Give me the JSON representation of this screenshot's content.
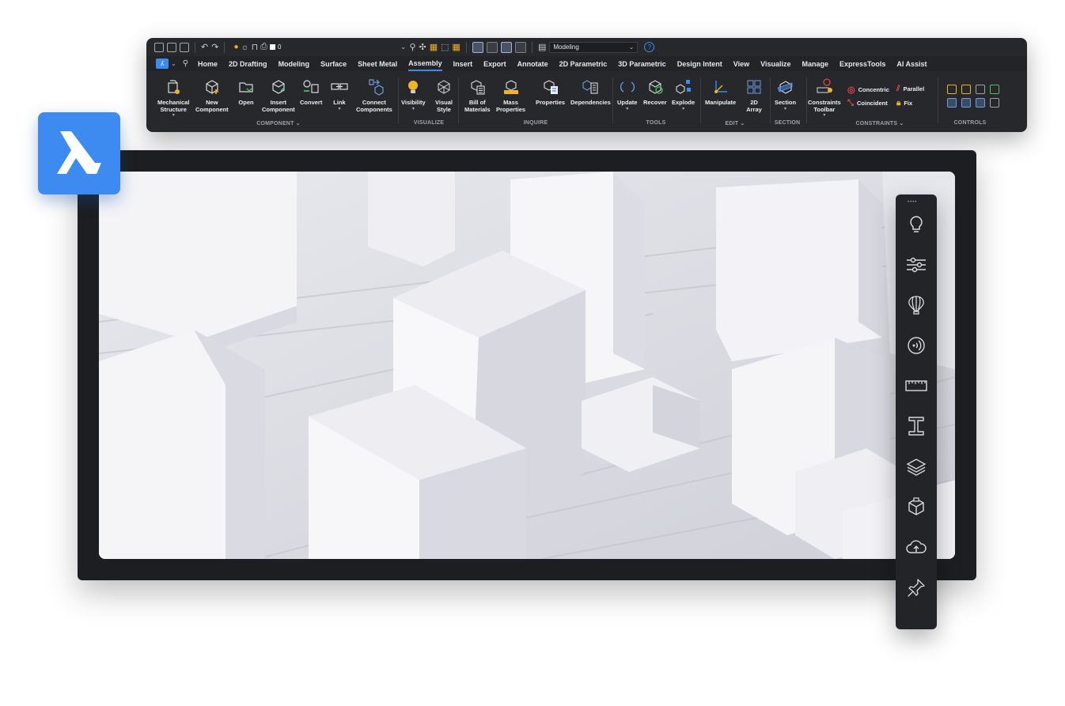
{
  "quick_access": {
    "layer_name": "0",
    "workspace": "Modeling",
    "help_label": "?"
  },
  "ribbon_tabs": [
    {
      "label": "Home"
    },
    {
      "label": "2D Drafting"
    },
    {
      "label": "Modeling"
    },
    {
      "label": "Surface"
    },
    {
      "label": "Sheet Metal"
    },
    {
      "label": "Assembly"
    },
    {
      "label": "Insert"
    },
    {
      "label": "Export"
    },
    {
      "label": "Annotate"
    },
    {
      "label": "2D Parametric"
    },
    {
      "label": "3D Parametric"
    },
    {
      "label": "Design Intent"
    },
    {
      "label": "View"
    },
    {
      "label": "Visualize"
    },
    {
      "label": "Manage"
    },
    {
      "label": "ExpressTools"
    },
    {
      "label": "AI Assist"
    }
  ],
  "active_tab": "Assembly",
  "panels": {
    "component": {
      "title": "COMPONENT ⌄",
      "tools": [
        "Mechanical\nStructure",
        "New\nComponent",
        "Open",
        "Insert\nComponent",
        "Convert",
        "Link",
        "Connect\nComponents"
      ]
    },
    "visualize": {
      "title": "VISUALIZE",
      "tools": [
        "Visibility",
        "Visual\nStyle"
      ]
    },
    "inquire": {
      "title": "INQUIRE",
      "tools": [
        "Bill of\nMaterials",
        "Mass\nProperties",
        "Properties",
        "Dependencies"
      ]
    },
    "tools": {
      "title": "TOOLS",
      "tools": [
        "Update",
        "Recover",
        "Explode"
      ]
    },
    "edit": {
      "title": "EDIT ⌄",
      "tools": [
        "Manipulate",
        "2D\nArray"
      ]
    },
    "section": {
      "title": "SECTION",
      "tools": [
        "Section"
      ]
    },
    "constraints": {
      "title": "CONSTRAINTS ⌄",
      "tools": [
        "Constraints\nToolbar"
      ],
      "small_tools": [
        "Concentric",
        "Coincident",
        "Parallel",
        "Fix"
      ]
    },
    "controls": {
      "title": "CONTROLS"
    }
  },
  "side_toolbar": {
    "grip": "••••",
    "icons": [
      "lightbulb-icon",
      "sliders-icon",
      "hot-air-balloon-icon",
      "sound-wave-icon",
      "ruler-icon",
      "i-beam-icon",
      "layers-icon",
      "cube-icon",
      "cloud-upload-icon",
      "pin-icon"
    ]
  },
  "colors": {
    "brand_blue": "#3d8bf0",
    "ribbon_bg": "#26282c",
    "viewport_frame": "#1d1e21",
    "accent_yellow": "#f0b323",
    "accent_red": "#e04848"
  }
}
